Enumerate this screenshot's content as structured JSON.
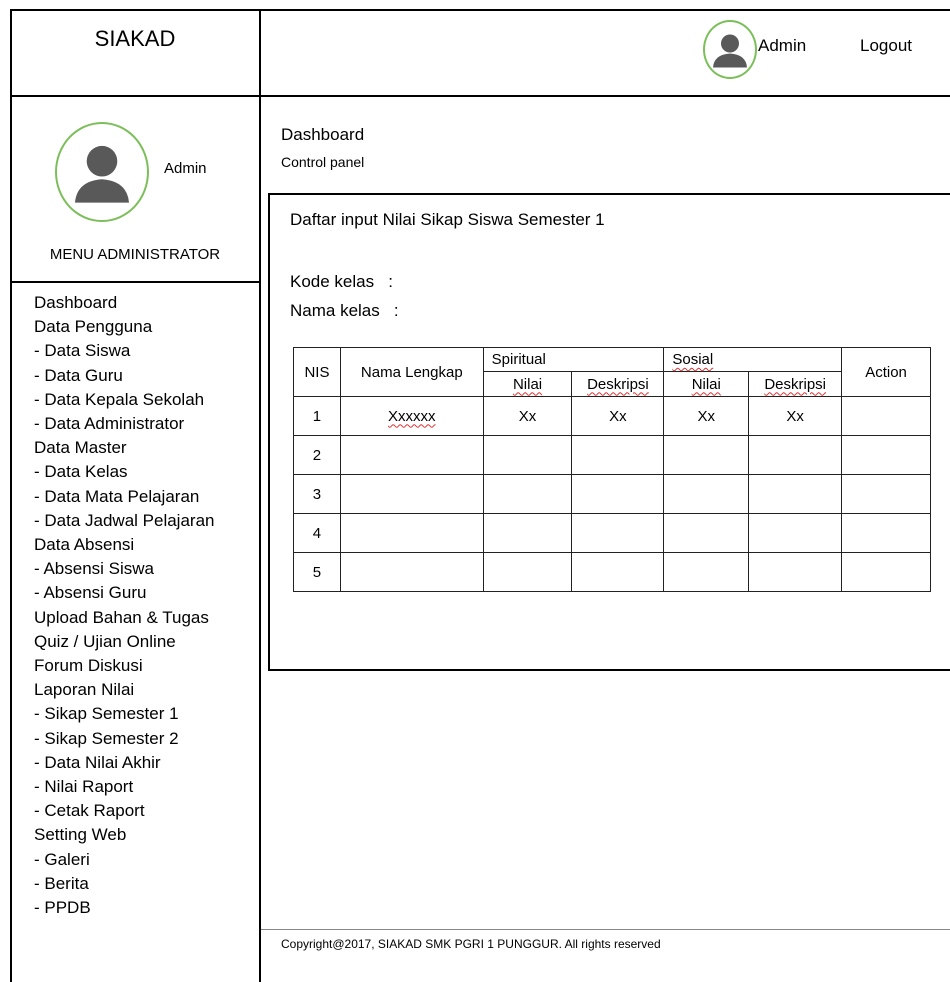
{
  "app_title": "SIAKAD",
  "header": {
    "user_name": "Admin",
    "logout_label": "Logout"
  },
  "sidebar": {
    "user_name": "Admin",
    "menu_title": "MENU ADMINISTRATOR",
    "items": [
      "Dashboard",
      "Data Pengguna",
      "- Data Siswa",
      "- Data Guru",
      "- Data Kepala Sekolah",
      "- Data Administrator",
      "Data Master",
      "- Data Kelas",
      "- Data Mata Pelajaran",
      "- Data Jadwal Pelajaran",
      "Data Absensi",
      "- Absensi Siswa",
      "- Absensi Guru",
      "Upload Bahan & Tugas",
      "Quiz / Ujian Online",
      "Forum Diskusi",
      "Laporan Nilai",
      "- Sikap Semester 1",
      "- Sikap Semester 2",
      "- Data Nilai Akhir",
      "- Nilai Raport",
      "- Cetak Raport",
      "Setting Web",
      "- Galeri",
      "- Berita",
      "- PPDB"
    ]
  },
  "page": {
    "title": "Dashboard",
    "subtitle": "Control panel"
  },
  "panel": {
    "title": "Daftar input Nilai Sikap Siswa Semester 1",
    "kode_kelas_label": "Kode kelas   :",
    "nama_kelas_label": "Nama kelas   :"
  },
  "table": {
    "headers": {
      "nis": "NIS",
      "nama": "Nama Lengkap",
      "spiritual": "Spiritual",
      "sosial": "Sosial",
      "nilai": "Nilai",
      "deskripsi": "Deskripsi",
      "action": "Action"
    },
    "rows": [
      [
        "1",
        "Xxxxxx",
        "Xx",
        "Xx",
        "Xx",
        "Xx",
        ""
      ],
      [
        "2",
        "",
        "",
        "",
        "",
        "",
        ""
      ],
      [
        "3",
        "",
        "",
        "",
        "",
        "",
        ""
      ],
      [
        "4",
        "",
        "",
        "",
        "",
        "",
        ""
      ],
      [
        "5",
        "",
        "",
        "",
        "",
        "",
        ""
      ]
    ]
  },
  "footer": {
    "copyright": "Copyright@2017, SIAKAD SMK PGRI 1 PUNGGUR. All rights reserved"
  },
  "colors": {
    "avatar_ring": "#7cbf5a",
    "avatar_fill": "#595959",
    "squiggle": "#d33333"
  },
  "icons": {
    "avatar": "user-silhouette-icon"
  }
}
